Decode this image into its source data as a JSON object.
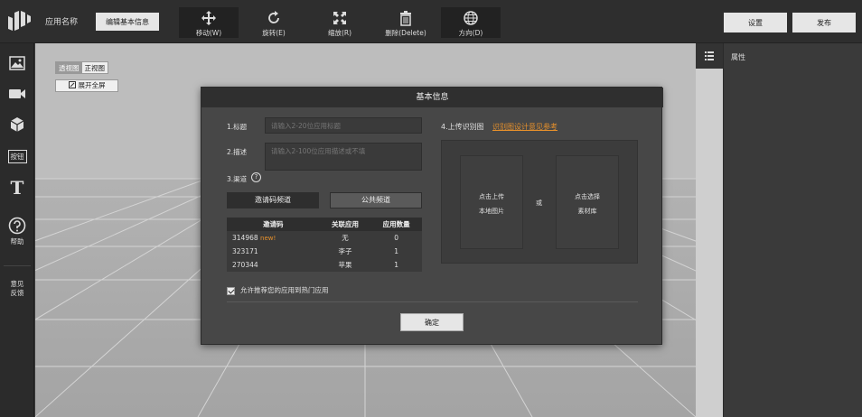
{
  "header": {
    "app_name": "应用名称",
    "edit_info_label": "编辑基本信息",
    "tools": [
      {
        "label": "移动(W)",
        "icon": "move-icon",
        "active": true
      },
      {
        "label": "旋转(E)",
        "icon": "rotate-icon",
        "active": false
      },
      {
        "label": "缩放(R)",
        "icon": "scale-icon",
        "active": false
      },
      {
        "label": "删除(Delete)",
        "icon": "trash-icon",
        "active": false
      },
      {
        "label": "方向(D)",
        "icon": "globe-icon",
        "active": true
      }
    ],
    "settings_label": "设置",
    "publish_label": "发布"
  },
  "sidebar": {
    "button_label": "按钮",
    "text_label": "T",
    "help_label": "帮助",
    "feedback_label": "意见反馈"
  },
  "viewport": {
    "view_tabs": [
      "透视图",
      "正视图"
    ],
    "active_view": "透视图",
    "fullscreen_label": "展开全屏"
  },
  "right_panel": {
    "title": "属性"
  },
  "modal": {
    "title": "基本信息",
    "title_label": "1.标题",
    "title_placeholder": "请输入2-20位应用标题",
    "desc_label": "2.描述",
    "desc_placeholder": "请输入2-100位应用描述或不填",
    "channel_label": "3.渠道",
    "channel_tabs": [
      "邀请码频道",
      "公共频道"
    ],
    "table": {
      "headers": [
        "邀请码",
        "关联应用",
        "应用数量"
      ],
      "rows": [
        {
          "code": "314968",
          "tag": "new!",
          "app": "无",
          "count": "0"
        },
        {
          "code": "323171",
          "tag": "",
          "app": "李子",
          "count": "1"
        },
        {
          "code": "270344",
          "tag": "",
          "app": "苹果",
          "count": "1"
        }
      ]
    },
    "upload_label": "4.上传识别图",
    "upload_link": "识别图设计意见参考",
    "upload_local_lines": [
      "点击上传",
      "本地图片"
    ],
    "or_label": "或",
    "upload_library_lines": [
      "点击选择",
      "素材库"
    ],
    "allow_label": "允许推荐您的应用到热门应用",
    "ok_label": "确定"
  }
}
